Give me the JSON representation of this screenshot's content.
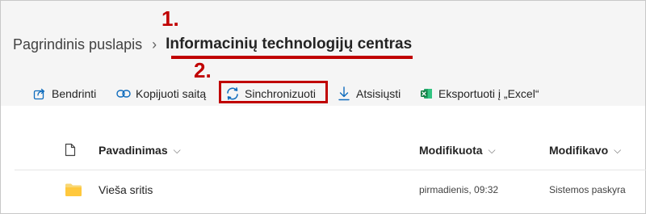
{
  "annotations": {
    "step1": "1.",
    "step2": "2."
  },
  "breadcrumb": {
    "home": "Pagrindinis puslapis",
    "separator": "›",
    "current": "Informacinių technologijų centras"
  },
  "commands": {
    "share": {
      "label": "Bendrinti",
      "icon": "share-icon"
    },
    "copy_link": {
      "label": "Kopijuoti saitą",
      "icon": "link-icon"
    },
    "sync": {
      "label": "Sinchronizuoti",
      "icon": "sync-icon"
    },
    "download": {
      "label": "Atsisiųsti",
      "icon": "download-icon"
    },
    "export": {
      "label": "Eksportuoti į „Excel“",
      "icon": "excel-icon"
    }
  },
  "table": {
    "columns": [
      {
        "label": "Pavadinimas",
        "chevron": "⌵"
      },
      {
        "label": "Modifikuota",
        "chevron": "⌵"
      },
      {
        "label": "Modifikavo",
        "chevron": "⌵"
      }
    ],
    "rows": [
      {
        "name": "Vieša sritis",
        "modified": "pirmadienis, 09:32",
        "modified_by": "Sistemos paskyra",
        "icon": "folder-icon"
      }
    ]
  },
  "colors": {
    "accent": "#0f6cbd",
    "annotation_red": "#c00000",
    "folder": "#f8d775",
    "excel_green": "#107c41"
  }
}
